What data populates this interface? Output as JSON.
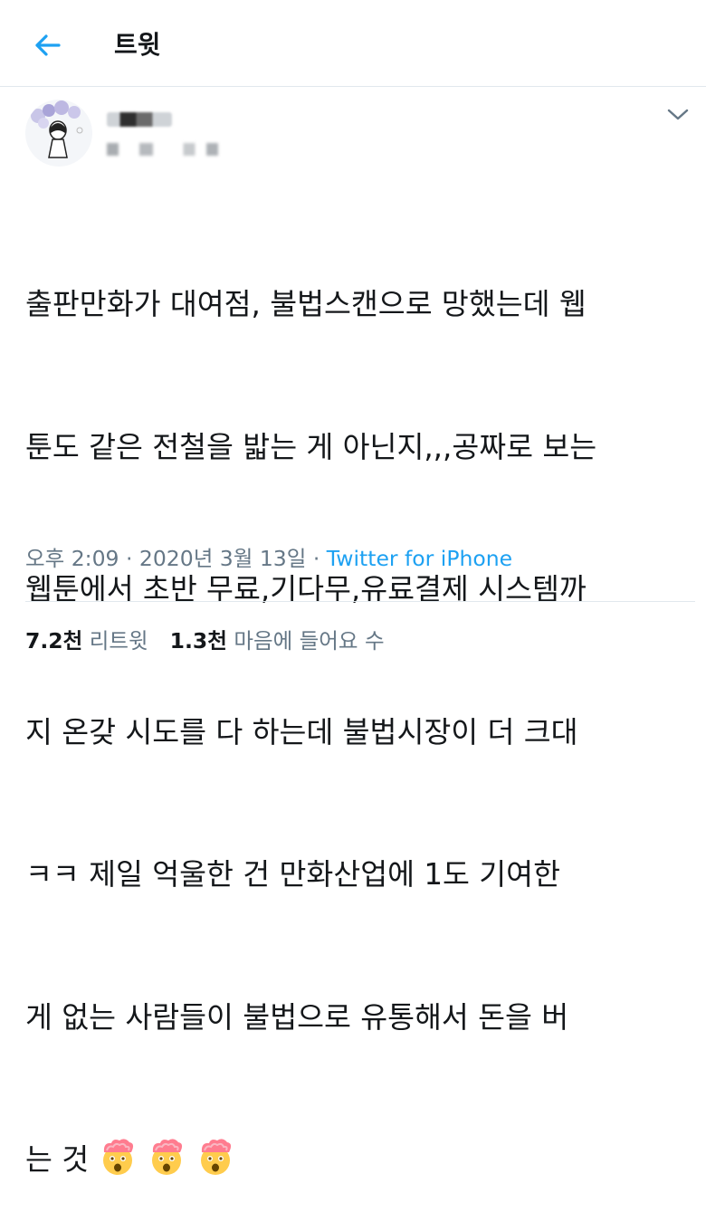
{
  "header": {
    "title": "트윗",
    "back_icon": "arrow-left-icon"
  },
  "tweet": {
    "text_lines": [
      "출판만화가 대여점, 불법스캔으로 망했는데 웹",
      "툰도 같은 전철을 밟는 게 아닌지,,,공짜로 보는",
      "웹툰에서 초반 무료,기다무,유료결제 시스템까",
      "지 온갖 시도를 다 하는데 불법시장이 더 크대",
      "ㅋㅋ 제일 억울한 건 만화산업에 1도 기여한",
      "게 없는 사람들이 불법으로 유통해서 돈을 버",
      "는 것"
    ],
    "emojis": [
      "exploding-head-icon",
      "exploding-head-icon",
      "exploding-head-icon"
    ],
    "time": "오후 2:09",
    "date": "2020년 3월 13일",
    "separator": " · ",
    "source": "Twitter for iPhone"
  },
  "stats": {
    "retweets_count": "7.2천",
    "retweets_label": "리트윗",
    "likes_count": "1.3천",
    "likes_label": "마음에 들어요 수"
  },
  "colors": {
    "accent": "#1da1f2",
    "muted": "#657786",
    "text": "#14171a",
    "divider": "#e1e8ed"
  }
}
